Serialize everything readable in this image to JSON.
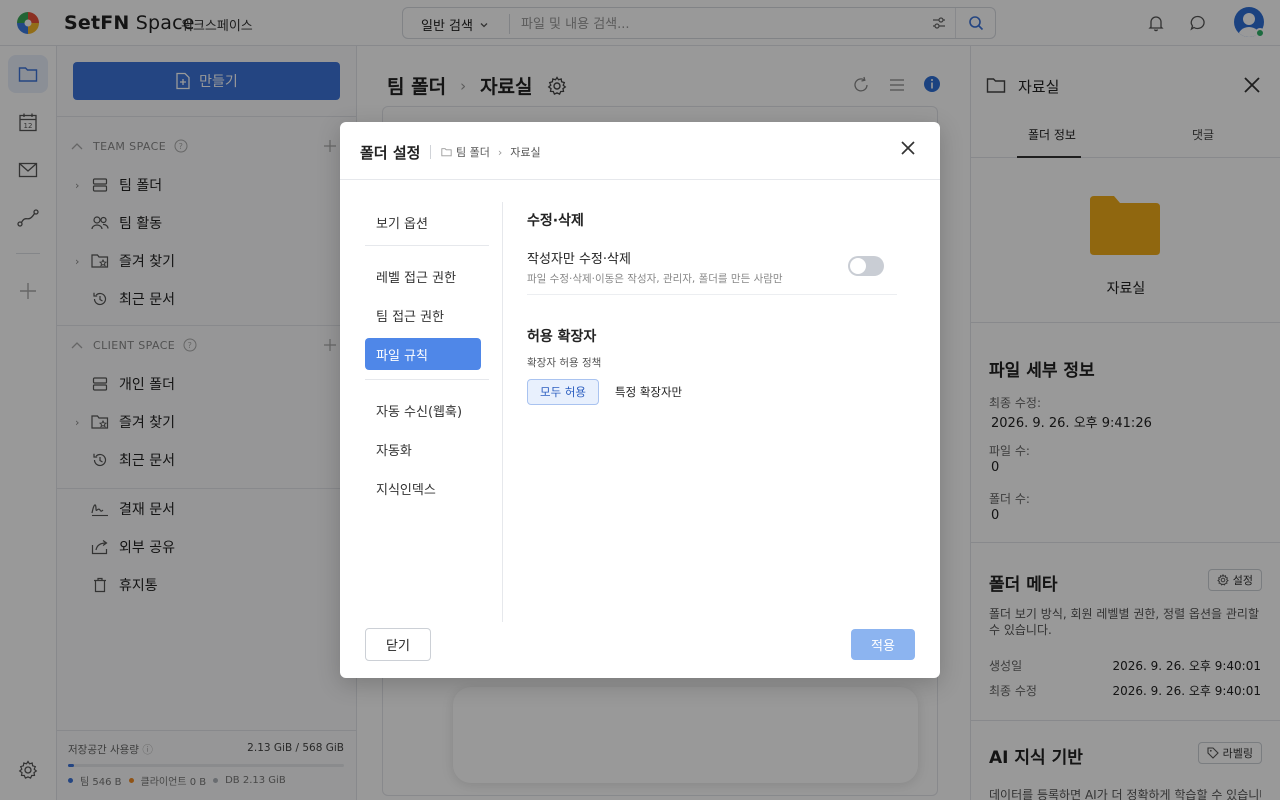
{
  "app": {
    "brand_bold": "SetFN",
    "brand_light": " Space",
    "workspace": "워크스페이스"
  },
  "search": {
    "mode": "일반 검색",
    "placeholder": "파일 및 내용 검색..."
  },
  "sidebar": {
    "create_label": "만들기",
    "team_space_title": "TEAM SPACE",
    "team_items": [
      {
        "label": "팀 폴더",
        "icon": "server-icon"
      },
      {
        "label": "팀 활동",
        "icon": "users-icon"
      },
      {
        "label": "즐겨 찾기",
        "icon": "folder-star-icon"
      },
      {
        "label": "최근 문서",
        "icon": "history-icon"
      }
    ],
    "client_space_title": "CLIENT SPACE",
    "client_items": [
      {
        "label": "개인 폴더",
        "icon": "server-icon"
      },
      {
        "label": "즐겨 찾기",
        "icon": "folder-star-icon"
      },
      {
        "label": "최근 문서",
        "icon": "history-icon"
      }
    ],
    "misc_items": [
      {
        "label": "결재 문서",
        "icon": "signature-icon"
      },
      {
        "label": "외부 공유",
        "icon": "share-icon"
      },
      {
        "label": "휴지통",
        "icon": "trash-icon"
      }
    ],
    "storage": {
      "label": "저장공간 사용량",
      "value": "2.13 GiB / 568 GiB",
      "fill_fraction": 0.02,
      "legend_team": "팀 546 B",
      "legend_client": "클라이언트 0 B",
      "legend_db": "DB 2.13 GiB",
      "color_team": "#3d74d9",
      "color_client": "#f08a24",
      "color_db": "#b0b4bb"
    }
  },
  "main": {
    "crumb_parent": "팀 폴더",
    "crumb_sep": "›",
    "crumb_current": "자료실"
  },
  "right_panel": {
    "title": "자료실",
    "tab_info": "폴더 정보",
    "tab_comments": "댓글",
    "folder_name": "자료실",
    "details_title": "파일 세부 정보",
    "last_modified_label": "최종 수정:",
    "last_modified_value": "2026. 9. 26. 오후 9:41:26",
    "file_count_label": "파일 수:",
    "file_count_value": "0",
    "folder_count_label": "폴더 수:",
    "folder_count_value": "0",
    "meta_title": "폴더 메타",
    "meta_button": "설정",
    "meta_desc": "폴더 보기 방식, 회원 레벨별 권한, 정렬 옵션을 관리할 수 있습니다.",
    "created_label": "생성일",
    "created_value": "2026. 9. 26. 오후 9:40:01",
    "modified_label": "최종 수정",
    "modified_value": "2026. 9. 26. 오후 9:40:01",
    "ai_title": "AI 지식 기반",
    "ai_button": "라벨링",
    "ai_desc": "데이터를 등록하면 AI가 더 정확하게 학습할 수 있습니다. 지"
  },
  "modal": {
    "title": "폴더 설정",
    "crumb_parent": "팀 폴더",
    "crumb_current": "자료실",
    "nav": [
      "보기 옵션",
      "레벨 접근 권한",
      "팀 접근 권한",
      "파일 규칙",
      "자동 수신(웹훅)",
      "자동화",
      "지식인덱스"
    ],
    "active_nav_index": 3,
    "section1_title": "수정·삭제",
    "author_only_label": "작성자만 수정·삭제",
    "author_only_desc": "파일 수정·삭제·이동은 작성자, 관리자, 폴더를 만든 사람만",
    "author_only_on": false,
    "section2_title": "허용 확장자",
    "policy_label": "확장자 허용 정책",
    "policy_all": "모두 허용",
    "policy_specific": "특정 확장자만",
    "close_label": "닫기",
    "apply_label": "적용"
  }
}
